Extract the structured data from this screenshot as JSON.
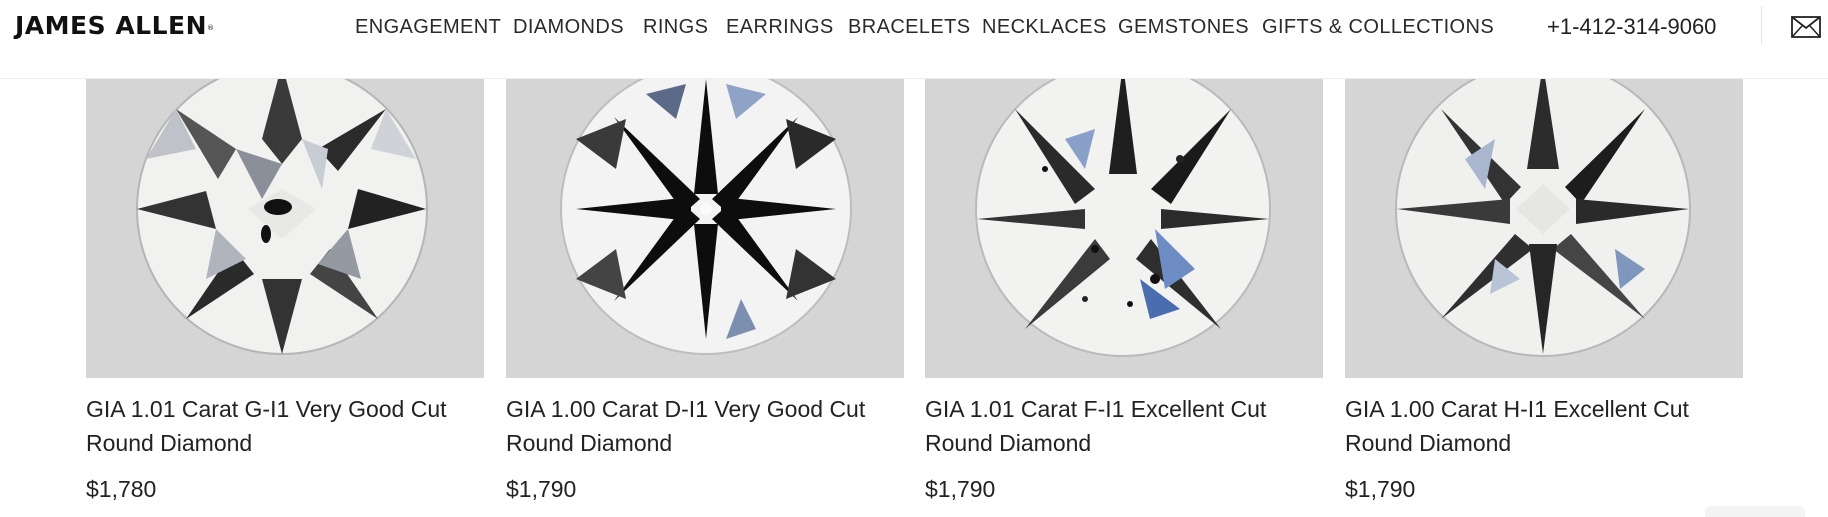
{
  "header": {
    "logo": "JAMES ALLEN",
    "logo_mark": "®",
    "nav": [
      {
        "label": "ENGAGEMENT"
      },
      {
        "label": "DIAMONDS"
      },
      {
        "label": "RINGS"
      },
      {
        "label": "EARRINGS"
      },
      {
        "label": "BRACELETS"
      },
      {
        "label": "NECKLACES"
      },
      {
        "label": "GEMSTONES"
      },
      {
        "label": "GIFTS & COLLECTIONS"
      }
    ],
    "phone": "+1-412-314-9060",
    "mail_icon": "envelope-icon"
  },
  "products": [
    {
      "title": "GIA 1.01 Carat G-I1 Very Good Cut Round Diamond",
      "price": "$1,780",
      "image_icon": "diamond-image"
    },
    {
      "title": "GIA 1.00 Carat D-I1 Very Good Cut Round Diamond",
      "price": "$1,790",
      "image_icon": "diamond-image"
    },
    {
      "title": "GIA 1.01 Carat F-I1 Excellent Cut Round Diamond",
      "price": "$1,790",
      "image_icon": "diamond-image"
    },
    {
      "title": "GIA 1.00 Carat H-I1 Excellent Cut Round Diamond",
      "price": "$1,790",
      "image_icon": "diamond-image"
    }
  ],
  "colors": {
    "image_background": "#d6d6d6",
    "text": "#222222"
  }
}
